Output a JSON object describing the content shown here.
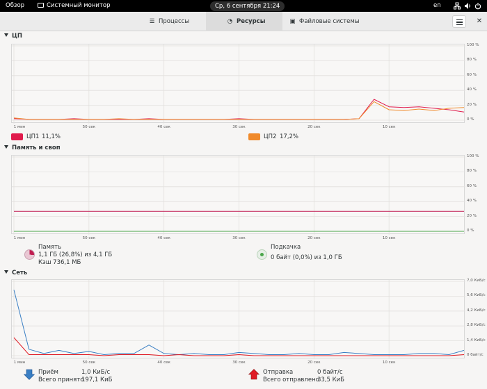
{
  "topbar": {
    "overview": "Обзор",
    "app_name": "Системный монитор",
    "datetime": "Ср, 6 сентября  21:24",
    "lang": "en"
  },
  "tabs": [
    {
      "label": "Процессы",
      "icon": "list-icon"
    },
    {
      "label": "Ресурсы",
      "icon": "gauge-icon"
    },
    {
      "label": "Файловые системы",
      "icon": "disk-icon"
    }
  ],
  "active_tab": "Ресурсы",
  "x_ticks": [
    "1 мин",
    "50 сек",
    "40 сек",
    "30 сек",
    "20 сек",
    "10 сек"
  ],
  "cpu": {
    "title": "ЦП",
    "y_ticks": [
      "100 %",
      "80 %",
      "60 %",
      "40 %",
      "20 %",
      "0 %"
    ],
    "cpu1_label": "ЦП1",
    "cpu1_value": "11,1%",
    "cpu1_color": "#e01b4c",
    "cpu2_label": "ЦП2",
    "cpu2_value": "17,2%",
    "cpu2_color": "#f08a2b"
  },
  "memory": {
    "title": "Память и своп",
    "y_ticks": [
      "100 %",
      "80 %",
      "60 %",
      "40 %",
      "20 %",
      "0 %"
    ],
    "mem_label": "Память",
    "mem_value": "1,1 ГБ (26,8%) из 4,1 ГБ",
    "mem_cache": "Кэш 736,1 МБ",
    "mem_color": "#c01c50",
    "swap_label": "Подкачка",
    "swap_value": "0 байт (0,0%) из 1,0 ГБ",
    "swap_color": "#4aa64a"
  },
  "network": {
    "title": "Сеть",
    "y_ticks": [
      "7,0 КиБ/с",
      "5,6 КиБ/с",
      "4,2 КиБ/с",
      "2,8 КиБ/с",
      "1,4 КиБ/с",
      "0 байт/с"
    ],
    "recv_label": "Приём",
    "recv_rate": "1,0 КиБ/с",
    "recv_total_label": "Всего принято",
    "recv_total": "197,1 КиБ",
    "recv_color": "#3a7fc4",
    "send_label": "Отправка",
    "send_rate": "0 байт/с",
    "send_total_label": "Всего отправлено",
    "send_total": "33,5 КиБ",
    "send_color": "#e01b24"
  },
  "chart_data": [
    {
      "type": "line",
      "title": "ЦП",
      "x": [
        60,
        58,
        56,
        54,
        52,
        50,
        48,
        46,
        44,
        42,
        40,
        38,
        36,
        34,
        32,
        30,
        28,
        26,
        24,
        22,
        20,
        18,
        16,
        14,
        12,
        10,
        8,
        6,
        4,
        2,
        0
      ],
      "x_unit": "сек",
      "ylim": [
        0,
        100
      ],
      "series": [
        {
          "name": "ЦП1",
          "values": [
            2,
            1,
            1,
            1,
            2,
            1,
            1,
            1,
            1,
            2,
            1,
            1,
            1,
            1,
            1,
            2,
            1,
            1,
            1,
            1,
            1,
            1,
            1,
            2,
            28,
            18,
            17,
            18,
            16,
            14,
            11
          ]
        },
        {
          "name": "ЦП2",
          "values": [
            3,
            1,
            1,
            1,
            1,
            1,
            1,
            2,
            1,
            1,
            1,
            1,
            1,
            1,
            1,
            1,
            1,
            1,
            1,
            1,
            1,
            1,
            1,
            2,
            25,
            14,
            13,
            15,
            13,
            16,
            17
          ]
        }
      ]
    },
    {
      "type": "line",
      "title": "Память и своп",
      "x": [
        60,
        0
      ],
      "x_unit": "сек",
      "ylim": [
        0,
        100
      ],
      "series": [
        {
          "name": "Память",
          "values": [
            26.8,
            26.8
          ]
        },
        {
          "name": "Подкачка",
          "values": [
            0,
            0
          ]
        }
      ]
    },
    {
      "type": "line",
      "title": "Сеть",
      "x": [
        60,
        58,
        56,
        54,
        52,
        50,
        48,
        46,
        44,
        42,
        40,
        38,
        36,
        34,
        32,
        30,
        28,
        26,
        24,
        22,
        20,
        18,
        16,
        14,
        12,
        10,
        8,
        6,
        4,
        2,
        0
      ],
      "x_unit": "сек",
      "ylim": [
        0,
        7.0
      ],
      "y_unit": "КиБ/с",
      "series": [
        {
          "name": "Приём",
          "values": [
            6.2,
            0.6,
            0.2,
            0.5,
            0.2,
            0.4,
            0.1,
            0.2,
            0.2,
            1.0,
            0.2,
            0.1,
            0.2,
            0.1,
            0.1,
            0.3,
            0.2,
            0.1,
            0.1,
            0.2,
            0.1,
            0.1,
            0.3,
            0.2,
            0.1,
            0.1,
            0.1,
            0.2,
            0.2,
            0.1,
            0.5
          ]
        },
        {
          "name": "Отправка",
          "values": [
            1.7,
            0.1,
            0.1,
            0.1,
            0.1,
            0.1,
            0.0,
            0.1,
            0.1,
            0.1,
            0.0,
            0.1,
            0.0,
            0.0,
            0.0,
            0.1,
            0.0,
            0.0,
            0.0,
            0.0,
            0.0,
            0.0,
            0.0,
            0.0,
            0.0,
            0.0,
            0.0,
            0.0,
            0.0,
            0.0,
            0.1
          ]
        }
      ]
    }
  ]
}
